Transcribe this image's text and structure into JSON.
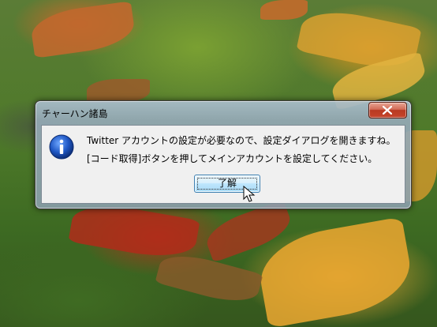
{
  "dialog": {
    "title": "チャーハン諸島",
    "message_line1": "Twitter アカウントの設定が必要なので、設定ダイアログを開きますね。",
    "message_line2": "[コード取得]ボタンを押してメインアカウントを設定してください。",
    "ok_label": "了解",
    "icon": "information-icon",
    "close_icon": "close-icon"
  },
  "colors": {
    "close_button": "#c6452c",
    "ok_button": "#bee6fd",
    "info_icon": "#1f57c4"
  }
}
